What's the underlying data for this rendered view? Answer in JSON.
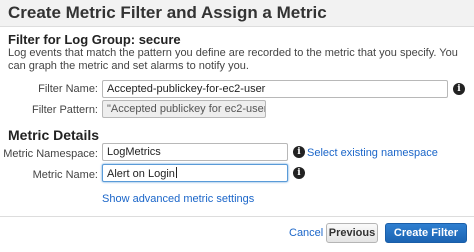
{
  "dialog": {
    "title": "Create Metric Filter and Assign a Metric"
  },
  "filter_section": {
    "heading": "Filter for Log Group: secure",
    "description": "Log events that match the pattern you define are recorded to the metric that you specify. You can graph the metric and set alarms to notify you.",
    "filter_name_label": "Filter Name:",
    "filter_name_value": "Accepted-publickey-for-ec2-user",
    "filter_pattern_label": "Filter Pattern:",
    "filter_pattern_value": "\"Accepted publickey for ec2-user\""
  },
  "metric_section": {
    "heading": "Metric Details",
    "namespace_label": "Metric Namespace:",
    "namespace_value": "LogMetrics",
    "select_namespace_link": "Select existing namespace",
    "metric_name_label": "Metric Name:",
    "metric_name_value": "Alert on Login",
    "advanced_link": "Show advanced metric settings"
  },
  "footer": {
    "cancel_label": "Cancel",
    "previous_label": "Previous",
    "create_label": "Create Filter"
  },
  "icons": {
    "info": "info-icon",
    "info_glyph": "i"
  },
  "colors": {
    "link": "#1b66c9",
    "primary_button": "#1b64b3",
    "header_background": "#f2f2f2"
  }
}
